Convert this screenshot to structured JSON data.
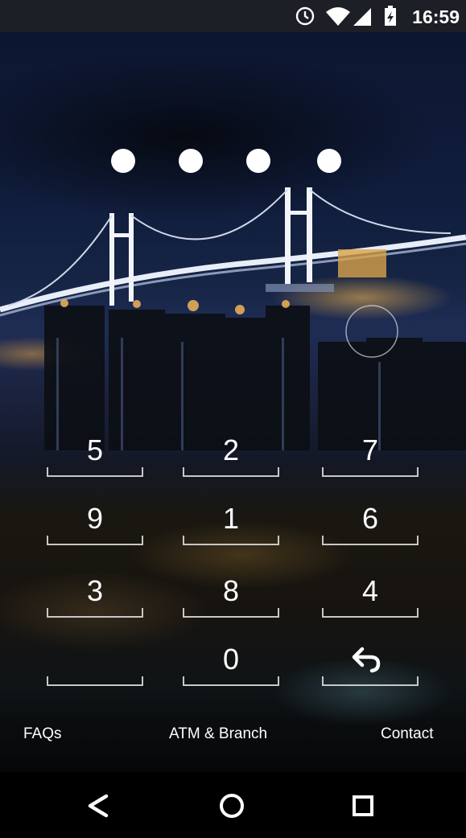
{
  "status_bar": {
    "time": "16:59",
    "icons": [
      "alarm-icon",
      "wifi-icon",
      "signal-icon",
      "battery-charging-icon"
    ]
  },
  "pin": {
    "length": 4,
    "filled": 4
  },
  "keypad": {
    "rows": [
      [
        "5",
        "2",
        "7"
      ],
      [
        "9",
        "1",
        "6"
      ],
      [
        "3",
        "8",
        "4"
      ],
      [
        "",
        "0",
        "backspace"
      ]
    ],
    "backspace_icon": "undo-arrow-icon"
  },
  "footer": {
    "faqs": "FAQs",
    "atm_branch": "ATM & Branch",
    "contact": "Contact"
  },
  "navigation": {
    "back_icon": "back-triangle-icon",
    "home_icon": "home-circle-icon",
    "recents_icon": "recents-square-icon"
  },
  "colors": {
    "status_bar_bg": "#1c1f26",
    "text": "#ffffff",
    "key_underline": "#c8c8c8"
  }
}
